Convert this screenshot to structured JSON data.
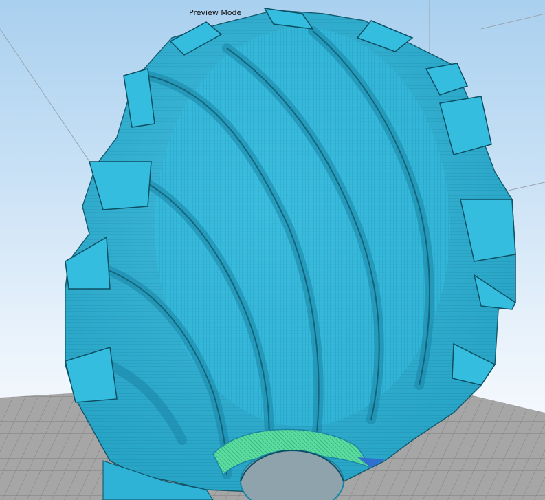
{
  "viewport": {
    "mode_label": "Preview Mode"
  },
  "colors": {
    "sky_top": "#a9d0ef",
    "sky_bottom": "#ffffff",
    "build_plate": "#a6a6a6",
    "plate_grid": "#7c7c7c",
    "bounding_box_lines": "#9aa4ad",
    "model_body": "#2eb3d6",
    "model_highlight": "#5fcbe6",
    "model_shadow": "#1a86a6",
    "model_edge": "#0d4f63",
    "first_layer_infill": "#5cdca0"
  },
  "icons": {
    "model": "3d-model-icon",
    "plate": "build-plate-icon"
  }
}
